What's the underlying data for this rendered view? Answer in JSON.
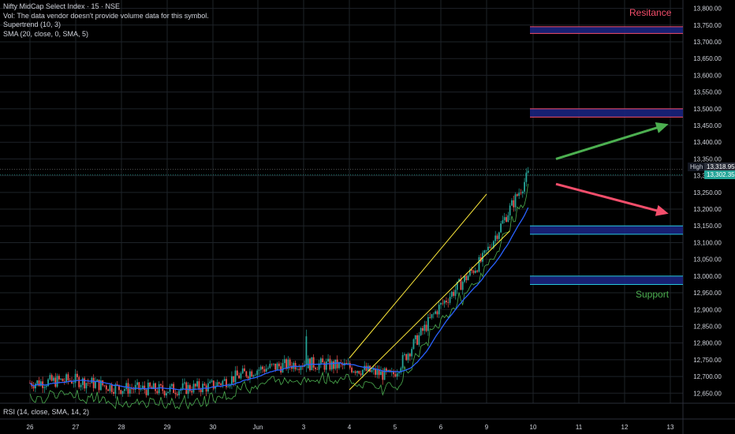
{
  "legend": {
    "title": "Nifty MidCap Select Index · 15 · NSE",
    "vol": "Vol: The data vendor doesn't provide volume data for this symbol.",
    "supertrend": "Supertrend (10, 3)",
    "sma": "SMA (20, close, 0, SMA, 5)"
  },
  "rsi_label": "RSI (14, close, SMA, 14, 2)",
  "zones": {
    "resistance_label": "Resitance",
    "support_label": "Support"
  },
  "price_tags": {
    "high_label": "High",
    "high_price": "13,318.95",
    "last_price": "13,302.35"
  },
  "colors": {
    "background": "#000000",
    "grid": "#1e2329",
    "axis_text": "#d1d4dc",
    "up_candle": "#26a69a",
    "down_candle": "#ef5350",
    "sma": "#2962ff",
    "supertrend_up": "#4caf50",
    "supertrend_down": "#ef5350",
    "channel": "#ffeb3b",
    "resistance_line": "#f44e6b",
    "support_line": "#26c6da",
    "zone_fill": "#1a237e",
    "arrow_up": "#4caf50",
    "arrow_down": "#f44e6b",
    "resistance_text": "#f44e6b",
    "support_text": "#4caf50"
  },
  "chart_data": {
    "type": "candlestick",
    "x_ticks": [
      "26",
      "27",
      "28",
      "29",
      "30",
      "Jun",
      "3",
      "4",
      "5",
      "6",
      "9",
      "10",
      "11",
      "12",
      "13"
    ],
    "y_ticks": [
      12650,
      12700,
      12750,
      12800,
      12850,
      12900,
      12950,
      13000,
      13050,
      13100,
      13150,
      13200,
      13250,
      13300,
      13350,
      13400,
      13450,
      13500,
      13550,
      13600,
      13650,
      13700,
      13750,
      13800
    ],
    "y_tick_labels": [
      "12,650.00",
      "12,700.00",
      "12,750.00",
      "12,800.00",
      "12,850.00",
      "12,900.00",
      "12,950.00",
      "13,000.00",
      "13,050.00",
      "13,100.00",
      "13,150.00",
      "13,200.00",
      "13,250.00",
      "13,300.00",
      "13,350.00",
      "13,400.00",
      "13,450.00",
      "13,500.00",
      "13,550.00",
      "13,600.00",
      "13,650.00",
      "13,700.00",
      "13,750.00",
      "13,800.00"
    ],
    "ylim": [
      12620,
      13825
    ],
    "day_close": [
      12690,
      12665,
      12660,
      12670,
      12720,
      12740,
      12730,
      12700,
      12900,
      13050,
      13302
    ],
    "high": 13318.95,
    "last": 13302.35,
    "resistance_zones": [
      [
        13725,
        13745
      ],
      [
        13475,
        13500
      ]
    ],
    "support_zones": [
      [
        13125,
        13150
      ],
      [
        12975,
        13000
      ]
    ],
    "channel": {
      "upper": [
        [
          "4",
          12755
        ],
        [
          "9",
          13245
        ]
      ],
      "lower": [
        [
          "4",
          12660
        ],
        [
          "9.5",
          13135
        ]
      ]
    },
    "arrows": [
      {
        "direction": "up",
        "from": [
          "10.5",
          13350
        ],
        "to": [
          "13",
          13450
        ]
      },
      {
        "direction": "down",
        "from": [
          "10.5",
          13275
        ],
        "to": [
          "13",
          13190
        ]
      }
    ]
  }
}
